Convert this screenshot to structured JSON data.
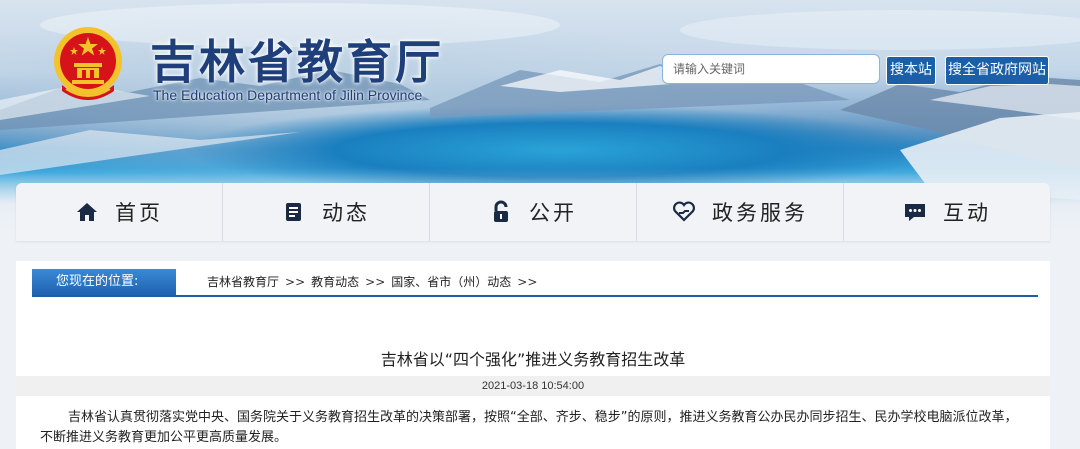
{
  "header": {
    "site_title": "吉林省教育厅",
    "site_subtitle": "The Education Department of Jilin Province",
    "search_placeholder": "请输入关键词",
    "search_button": "搜本站",
    "search_gov_button": "搜全省政府网站"
  },
  "nav": {
    "items": [
      {
        "label": "首页",
        "icon": "home-icon"
      },
      {
        "label": "动态",
        "icon": "document-icon"
      },
      {
        "label": "公开",
        "icon": "lock-icon"
      },
      {
        "label": "政务服务",
        "icon": "heart-hand-icon"
      },
      {
        "label": "互动",
        "icon": "chat-icon"
      }
    ]
  },
  "breadcrumb": {
    "tag": "您现在的位置:",
    "links": [
      "吉林省教育厅",
      "教育动态",
      "国家、省市（州）动态"
    ],
    "separator": ">>"
  },
  "article": {
    "title": "吉林省以“四个强化”推进义务教育招生改革",
    "date": "2021-03-18 10:54:00",
    "body": "吉林省认真贯彻落实党中央、国务院关于义务教育招生改革的决策部署，按照“全部、齐步、稳步”的原则，推进义务教育公办民办同步招生、民办学校电脑派位改革，不断推进义务教育更加公平更高质量发展。"
  },
  "colors": {
    "brand_blue": "#1b5fa8",
    "title_blue": "#1f3f7a",
    "emblem_red": "#d7131a",
    "emblem_gold": "#f3c32c"
  }
}
